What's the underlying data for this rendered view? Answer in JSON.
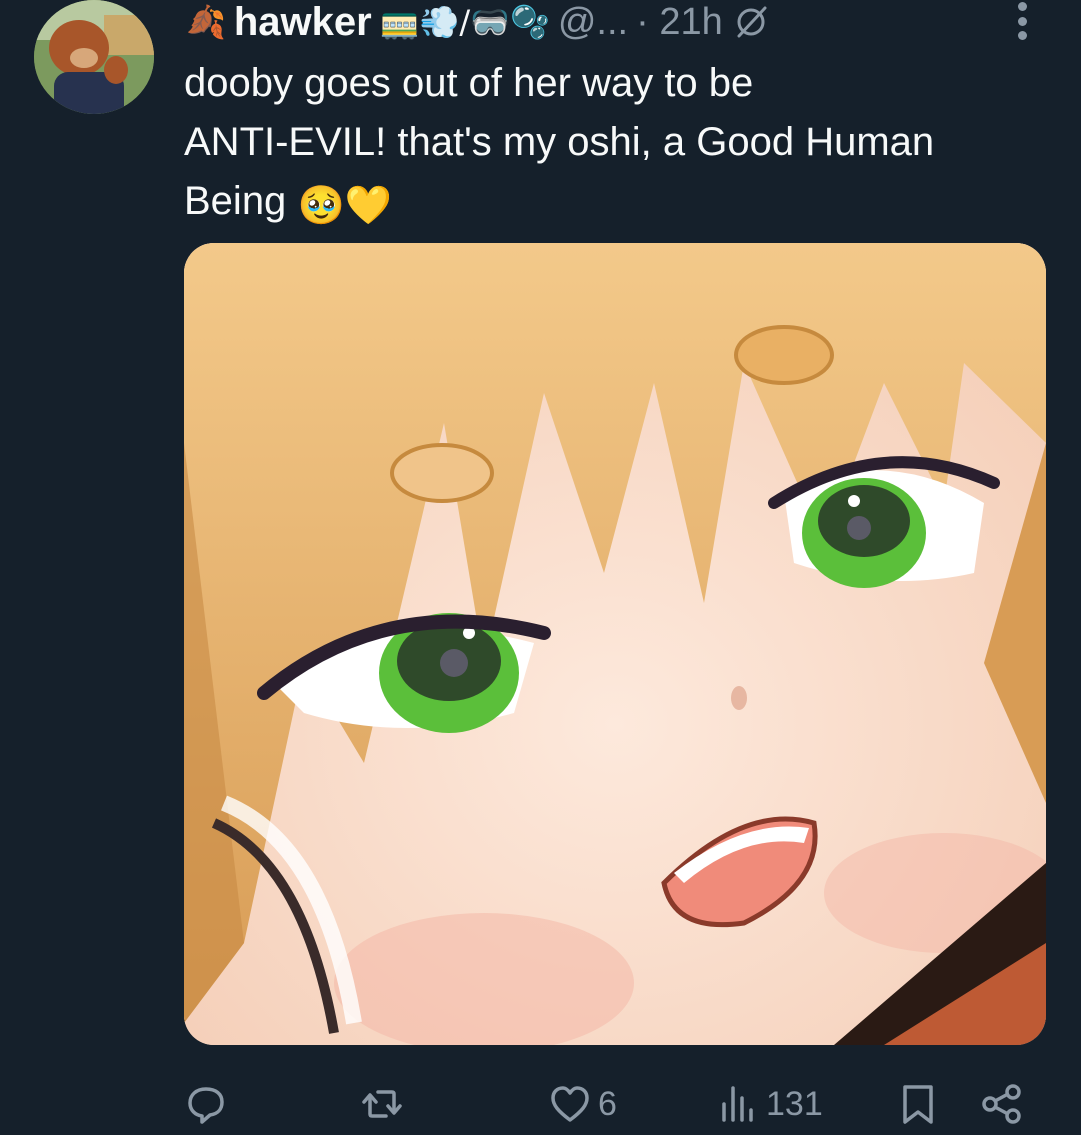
{
  "tweet": {
    "display_name": "hawker",
    "name_emojis_before": "🍂",
    "name_emojis_after": "🚃💨/🥽🫧",
    "handle": "@...",
    "time": "· 21h",
    "text_line_1": "dooby goes out of her way to be",
    "text_line_2": "ANTI-EVIL! that's my oshi, a Good Human",
    "text_line_3": "Being",
    "text_emojis": "🥹💛"
  },
  "actions": {
    "reply_count": "",
    "retweet_count": "",
    "like_count": "6",
    "views_count": "131"
  },
  "icons": {
    "reply": "reply-icon",
    "retweet": "retweet-icon",
    "like": "heart-icon",
    "views": "views-icon",
    "bookmark": "bookmark-icon",
    "share": "share-icon"
  },
  "colors": {
    "background": "#15202b",
    "text_primary": "#f7f9f9",
    "text_secondary": "#8b98a5"
  }
}
